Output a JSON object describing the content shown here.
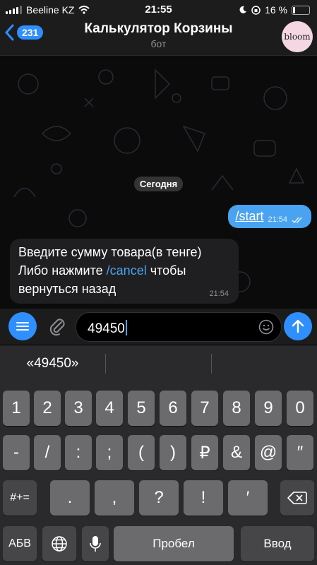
{
  "status": {
    "carrier": "Beeline KZ",
    "time": "21:55",
    "battery_percent": "16 %",
    "battery_level": 0.16
  },
  "header": {
    "back_count": "231",
    "title": "Калькулятор Корзины",
    "subtitle": "бот",
    "avatar_text": "bloom"
  },
  "chat": {
    "date": "Сегодня",
    "outgoing": {
      "text": "/start",
      "time": "21:54"
    },
    "incoming": {
      "line1": "Введите сумму товара(в тенге)",
      "line2_prefix": "Либо нажмите ",
      "line2_link": "/cancel",
      "line2_suffix": " чтобы",
      "line3": "вернуться назад",
      "time": "21:54"
    }
  },
  "input": {
    "value": "49450"
  },
  "suggestions": [
    "«49450»",
    "",
    ""
  ],
  "keyboard": {
    "row1": [
      "1",
      "2",
      "3",
      "4",
      "5",
      "6",
      "7",
      "8",
      "9",
      "0"
    ],
    "row2": [
      "-",
      "/",
      ":",
      ";",
      "(",
      ")",
      "₽",
      "&",
      "@",
      "″"
    ],
    "row3": [
      "#+=",
      ".",
      ",",
      "?",
      "!",
      "′"
    ],
    "row4": {
      "lang": "АБВ",
      "space": "Пробел",
      "enter": "Ввод"
    }
  },
  "colors": {
    "accent": "#2f8fff",
    "outgoing_bubble": "#4aa3f0",
    "incoming_bubble": "#1f1f21"
  }
}
